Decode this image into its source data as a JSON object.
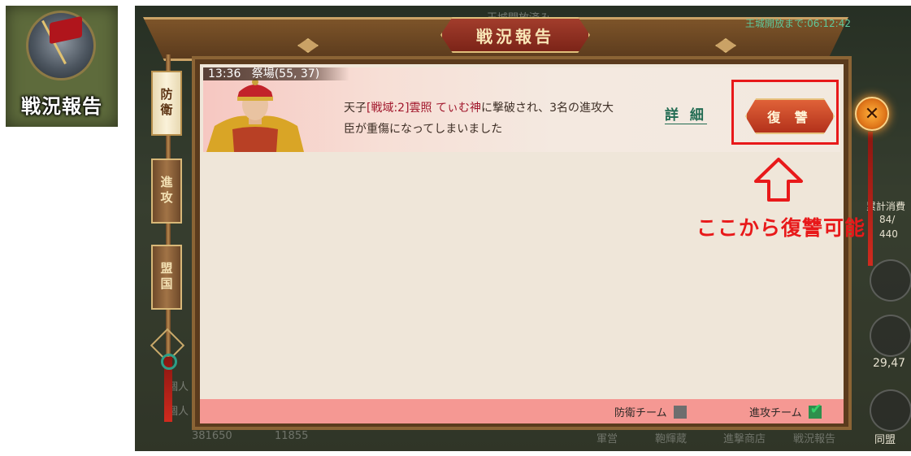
{
  "thumbnail": {
    "label": "戦況報告",
    "icon": "war-report-icon"
  },
  "header": {
    "title": "戦況報告",
    "timer": "王城開放まで:06:12:42",
    "faded_top": "王城開放済み"
  },
  "tabs": [
    {
      "label": "防衛",
      "active": true
    },
    {
      "label": "進攻",
      "active": false
    },
    {
      "label": "盟国",
      "active": false
    }
  ],
  "report": {
    "time": "13:36",
    "location": "祭場(55, 37)",
    "message_prefix": "天子",
    "message_highlight": "[戦域:2]雲照 てぃむ神",
    "message_suffix": "に撃破され、3名の進攻大臣が重傷になってしまいました",
    "detail_label": "詳 細",
    "revenge_label": "復 讐"
  },
  "annotation": {
    "text": "ここから復讐可能",
    "color": "#e8191a"
  },
  "footer": {
    "defense_team_label": "防衛チーム",
    "attack_team_label": "進攻チーム",
    "defense_checked": false,
    "attack_checked": true
  },
  "hud": {
    "cumulative_label": "累計消費",
    "cumulative_value": "84/",
    "cumulative_max": "440",
    "coords": "29,47",
    "alliance": "同盟",
    "bottom_left_a": "381650",
    "bottom_left_b": "11855",
    "bottom_menu": [
      "軍営",
      "鞄輝蔵",
      "進撃商店",
      "戦況報告"
    ],
    "side_left": [
      "個人",
      "個人"
    ]
  }
}
